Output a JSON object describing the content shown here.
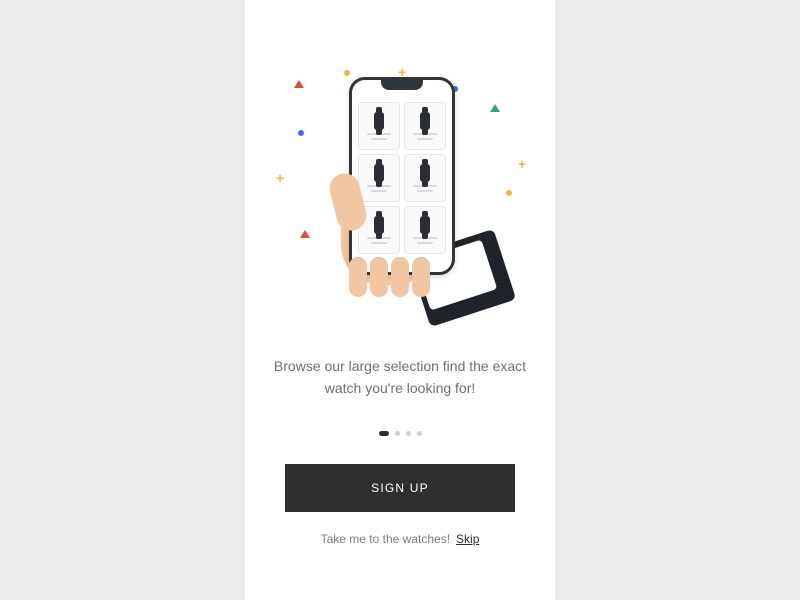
{
  "onboarding": {
    "description": "Browse our large selection find the exact watch you're looking for!",
    "pager": {
      "count": 4,
      "active_index": 0
    },
    "cta_label": "SIGN UP",
    "skip_prompt": "Take me to the watches!",
    "skip_label": "Skip"
  }
}
